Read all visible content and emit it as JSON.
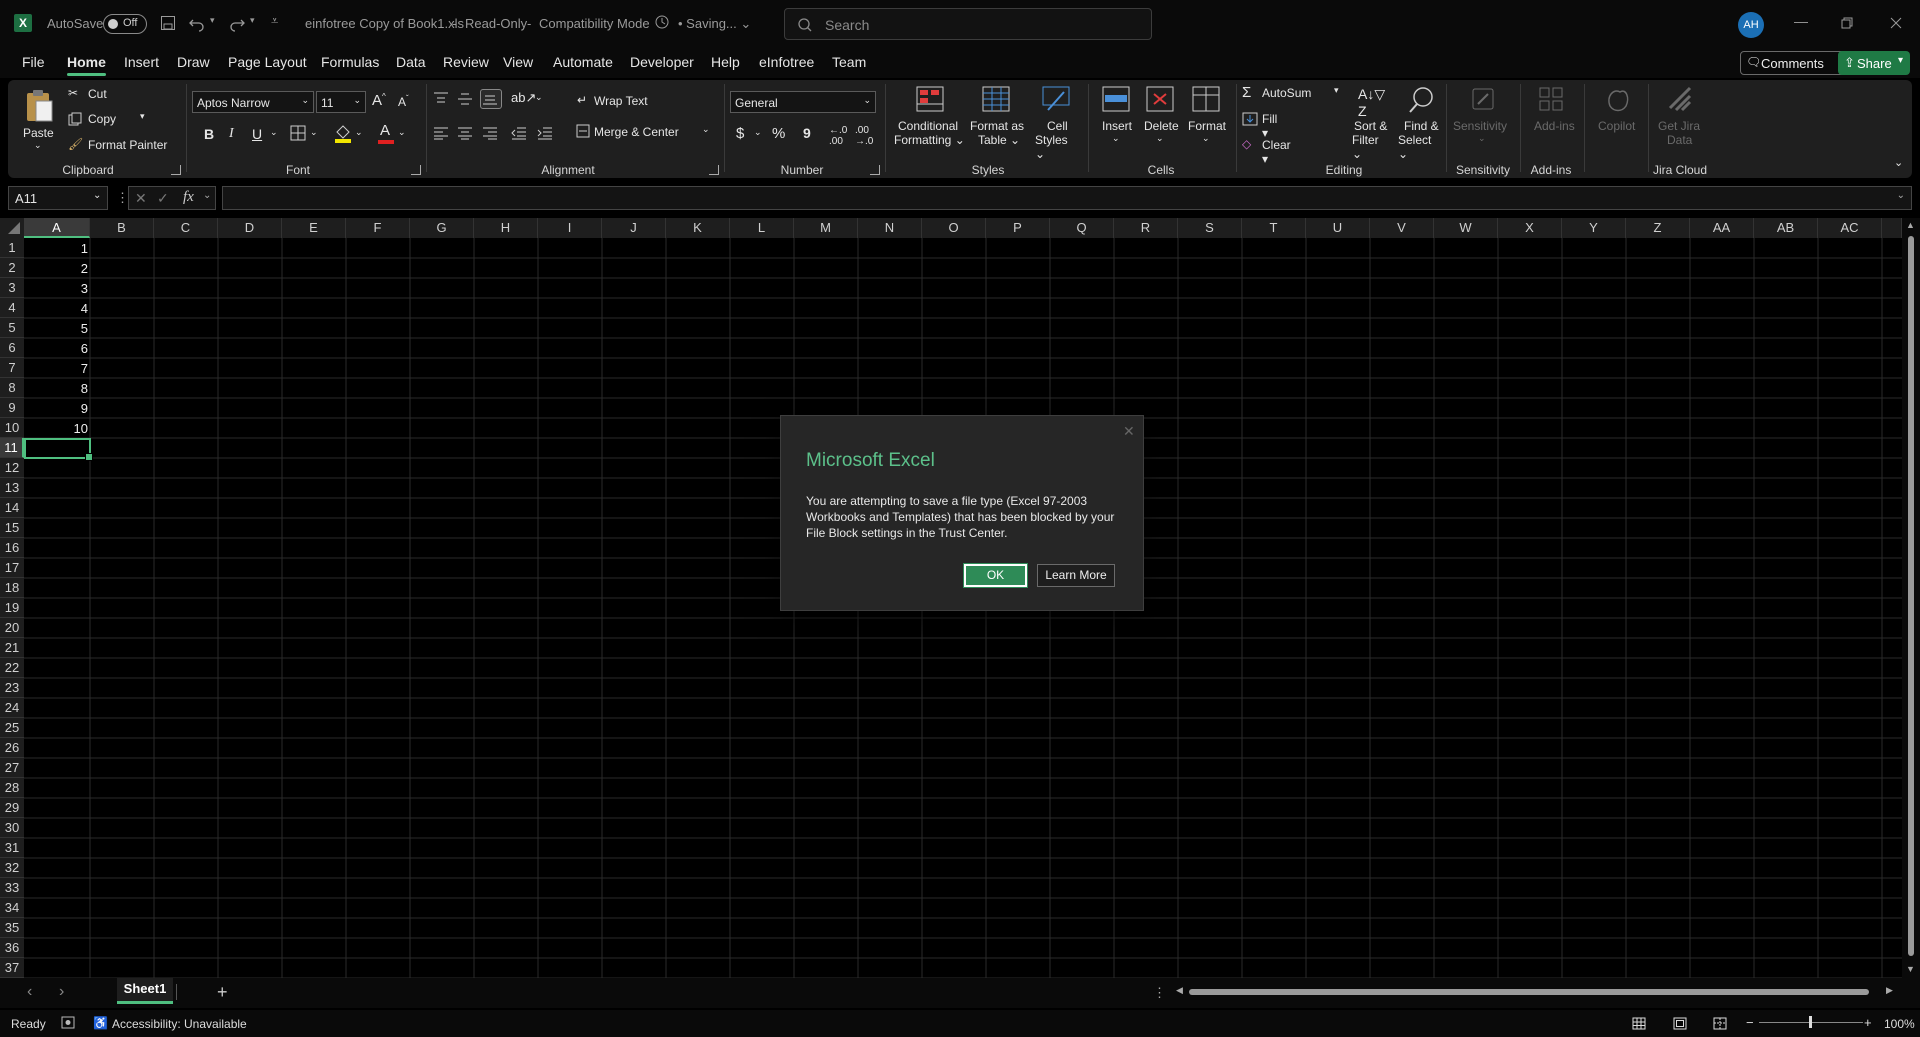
{
  "titlebar": {
    "autosave_label": "AutoSave",
    "autosave_state": "Off",
    "filename": "einfotree Copy of Book1.xls",
    "mode1": "Read-Only",
    "mode2": "Compatibility Mode",
    "saving": "Saving...",
    "search_placeholder": "Search",
    "avatar_initials": "AH"
  },
  "menu": {
    "tabs": [
      "File",
      "Home",
      "Insert",
      "Draw",
      "Page Layout",
      "Formulas",
      "Data",
      "Review",
      "View",
      "Automate",
      "Developer",
      "Help",
      "eInfotree",
      "Team"
    ],
    "active": "Home",
    "comments": "Comments",
    "share": "Share"
  },
  "ribbon": {
    "clipboard": {
      "paste": "Paste",
      "cut": "Cut",
      "copy": "Copy",
      "format_painter": "Format Painter",
      "label": "Clipboard"
    },
    "font": {
      "name": "Aptos Narrow",
      "size": "11",
      "label": "Font",
      "bold": "B",
      "italic": "I",
      "underline": "U"
    },
    "alignment": {
      "wrap": "Wrap Text",
      "merge": "Merge & Center",
      "label": "Alignment"
    },
    "number": {
      "format": "General",
      "label": "Number",
      "currency": "$",
      "percent": "%",
      "comma": "9"
    },
    "styles": {
      "cond1": "Conditional",
      "cond2": "Formatting",
      "fmt1": "Format as",
      "fmt2": "Table",
      "cell1": "Cell",
      "cell2": "Styles",
      "label": "Styles"
    },
    "cells": {
      "insert": "Insert",
      "delete": "Delete",
      "format": "Format",
      "label": "Cells"
    },
    "editing": {
      "autosum": "AutoSum",
      "fill": "Fill",
      "clear": "Clear",
      "sort1": "Sort &",
      "sort2": "Filter",
      "find1": "Find &",
      "find2": "Select",
      "label": "Editing"
    },
    "sensitivity": {
      "btn": "Sensitivity",
      "label": "Sensitivity"
    },
    "addins": {
      "btn": "Add-ins",
      "label": "Add-ins"
    },
    "copilot": {
      "btn": "Copilot"
    },
    "jira": {
      "btn1": "Get Jira",
      "btn2": "Data",
      "label": "Jira Cloud"
    }
  },
  "formula_bar": {
    "name_box": "A11",
    "fx": "fx",
    "value": ""
  },
  "grid": {
    "columns": [
      "A",
      "B",
      "C",
      "D",
      "E",
      "F",
      "G",
      "H",
      "I",
      "J",
      "K",
      "L",
      "M",
      "N",
      "O",
      "P",
      "Q",
      "R",
      "S",
      "T",
      "U",
      "V",
      "W",
      "X",
      "Y",
      "Z",
      "AA",
      "AB",
      "AC"
    ],
    "row_count": 37,
    "column_a_values": [
      "1",
      "2",
      "3",
      "4",
      "5",
      "6",
      "7",
      "8",
      "9",
      "10"
    ],
    "selected_cell": "A11"
  },
  "sheets": {
    "tabs": [
      "Sheet1"
    ],
    "active": "Sheet1"
  },
  "status": {
    "ready": "Ready",
    "accessibility": "Accessibility: Unavailable",
    "zoom": "100%"
  },
  "dialog": {
    "title": "Microsoft Excel",
    "message": "You are attempting to save a file type (Excel 97-2003 Workbooks and Templates) that has been blocked by your File Block settings in the Trust Center.",
    "ok": "OK",
    "learn_more": "Learn More"
  },
  "colors": {
    "accent": "#4fbf80",
    "dialog_title": "#5cc08a",
    "ok_button": "#2e8b57",
    "share": "#1f7a45",
    "excel_icon": "#1d6f42"
  }
}
